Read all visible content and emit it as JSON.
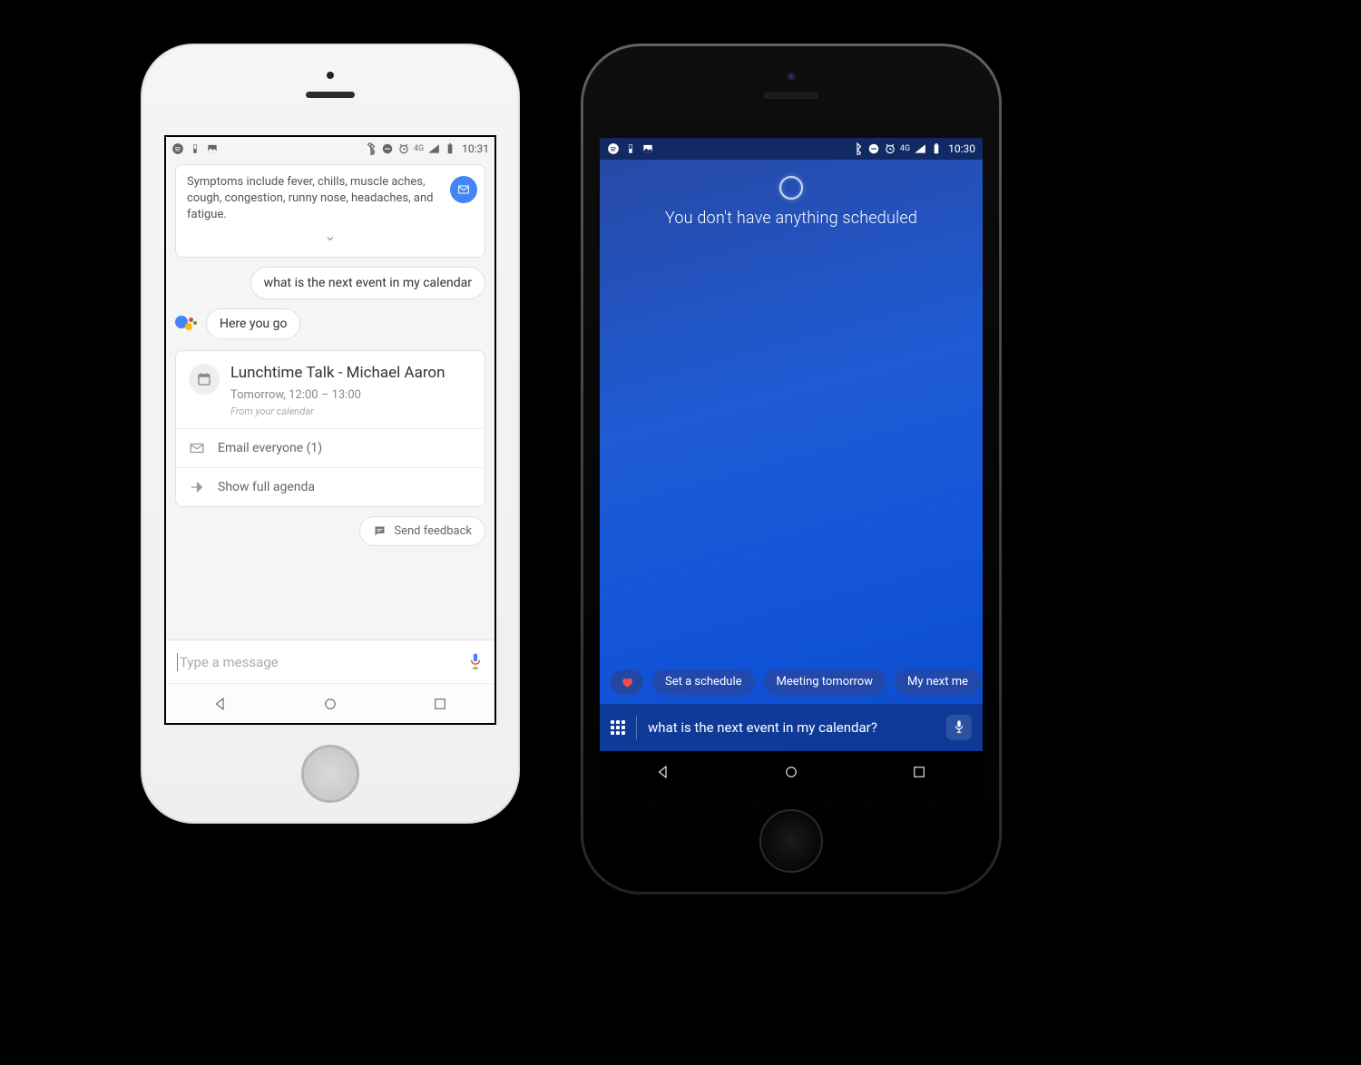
{
  "left_phone": {
    "statusbar": {
      "time": "10:31",
      "network": "4G"
    },
    "snippet": "Symptoms include fever, chills, muscle aches, cough, congestion, runny nose, headaches, and fatigue.",
    "user_query": "what is the next event in my calendar",
    "assistant_reply": "Here you go",
    "event": {
      "title": "Lunchtime Talk - Michael Aaron",
      "time": "Tomorrow, 12:00 – 13:00",
      "source": "From your calendar",
      "actions": {
        "email": "Email everyone (1)",
        "agenda": "Show full agenda"
      }
    },
    "feedback_label": "Send feedback",
    "input_placeholder": "Type a message"
  },
  "right_phone": {
    "statusbar": {
      "time": "10:30",
      "network": "4G"
    },
    "message": "You don't have anything scheduled",
    "suggestions": [
      "Set a schedule",
      "Meeting tomorrow",
      "My next me"
    ],
    "input_value": "what is the next event in my calendar?"
  }
}
